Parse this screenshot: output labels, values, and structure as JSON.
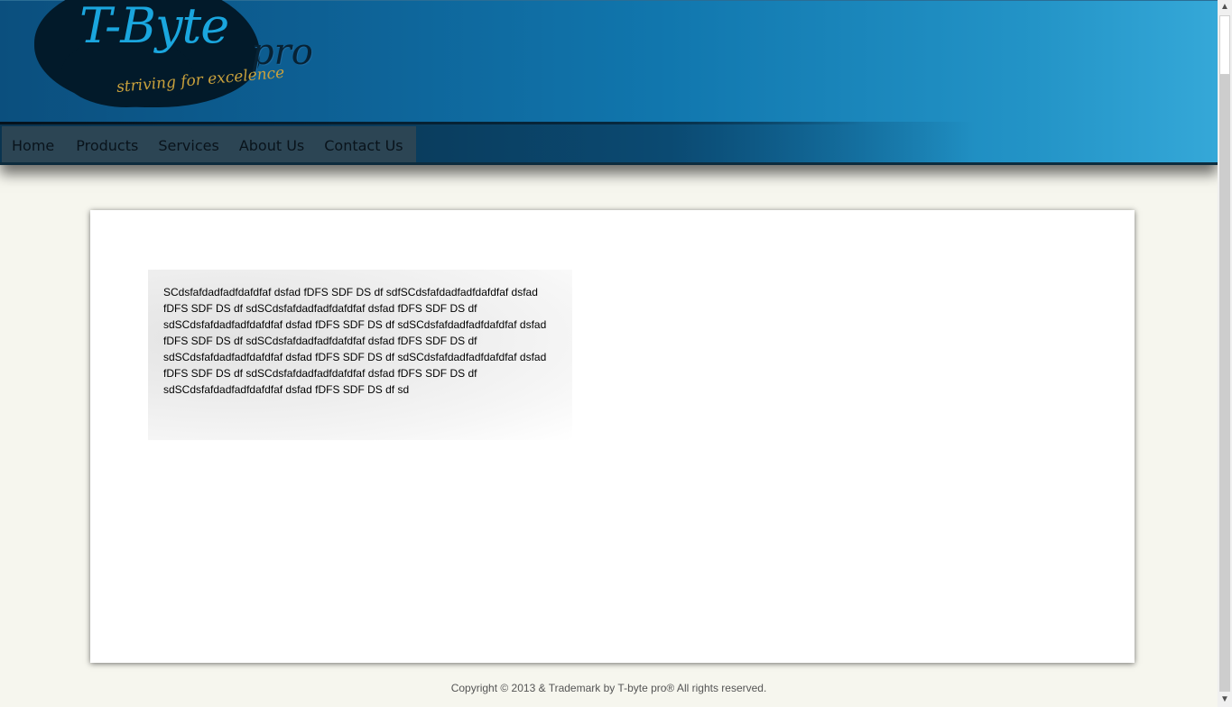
{
  "brand": {
    "name": "T-Byte",
    "suffix": "pro",
    "tagline": "striving for excelence"
  },
  "nav": {
    "items": [
      {
        "label": "Home"
      },
      {
        "label": "Products"
      },
      {
        "label": "Services"
      },
      {
        "label": "About Us"
      },
      {
        "label": "Contact Us"
      }
    ]
  },
  "content": {
    "paragraph": "SCdsfafdadfadfdafdfaf dsfad fDFS SDF DS df sdfSCdsfafdadfadfdafdfaf dsfad fDFS SDF DS df sdSCdsfafdadfadfdafdfaf dsfad fDFS SDF DS df sdSCdsfafdadfadfdafdfaf dsfad fDFS SDF DS df sdSCdsfafdadfadfdafdfaf dsfad fDFS SDF DS df sdSCdsfafdadfadfdafdfaf dsfad fDFS SDF DS df sdSCdsfafdadfadfdafdfaf dsfad fDFS SDF DS df sdSCdsfafdadfadfdafdfaf dsfad fDFS SDF DS df sdSCdsfafdadfadfdafdfaf dsfad fDFS SDF DS df sdSCdsfafdadfadfdafdfaf dsfad fDFS SDF DS df sd"
  },
  "footer": {
    "text": "Copyright © 2013 & Trademark by T-byte pro® All rights reserved."
  },
  "scrollbar": {
    "up_icon": "▲",
    "down_icon": "▼"
  }
}
